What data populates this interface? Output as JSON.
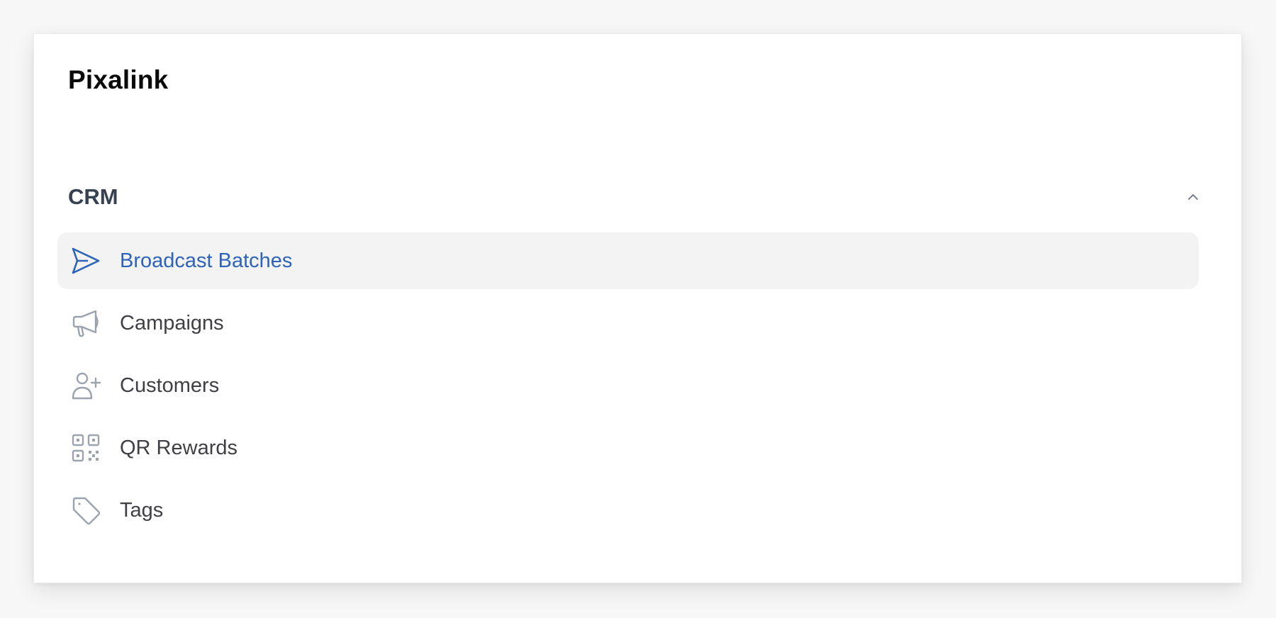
{
  "brand": {
    "name": "Pixalink"
  },
  "sidebar": {
    "group": {
      "title": "CRM",
      "expanded": true,
      "chevron_icon": "chevron-up-icon"
    },
    "items": [
      {
        "label": "Broadcast Batches",
        "icon": "send-icon",
        "active": true
      },
      {
        "label": "Campaigns",
        "icon": "megaphone-icon",
        "active": false
      },
      {
        "label": "Customers",
        "icon": "user-plus-icon",
        "active": false
      },
      {
        "label": "QR Rewards",
        "icon": "qr-code-icon",
        "active": false
      },
      {
        "label": "Tags",
        "icon": "tag-icon",
        "active": false
      }
    ]
  },
  "colors": {
    "accent": "#2d63b8",
    "active_bg": "#f3f3f4",
    "icon_muted": "#9ca3af",
    "text": "#3f3f46",
    "group_title": "#374151"
  }
}
